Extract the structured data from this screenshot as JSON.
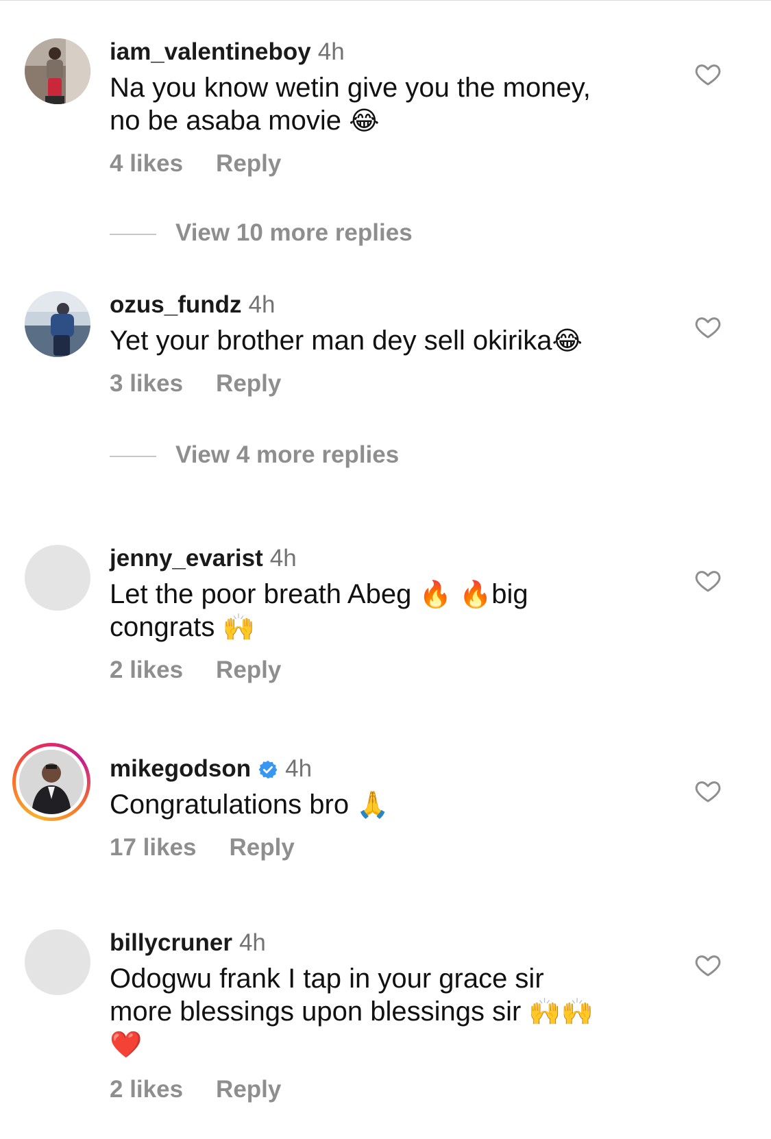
{
  "comments": [
    {
      "username": "iam_valentineboy",
      "time": "4h",
      "text_line1": "Na you know wetin give you the money,",
      "text_line2": "no be asaba movie",
      "emoji": "😂",
      "likes": "4 likes",
      "reply": "Reply",
      "view_replies": "View 10 more replies"
    },
    {
      "username": "ozus_fundz",
      "time": "4h",
      "text_line1": "Yet your brother man dey sell okirika",
      "emoji": "😂",
      "likes": "3 likes",
      "reply": "Reply",
      "view_replies": "View 4 more replies"
    },
    {
      "username": "jenny_evarist",
      "time": "4h",
      "text_line1": "Let the poor breath Abeg",
      "emoji_fire": "🔥",
      "text_line1_end": "big",
      "text_line2": "congrats",
      "emoji_hands": "🙌",
      "likes": "2 likes",
      "reply": "Reply"
    },
    {
      "username": "mikegodson",
      "verified": true,
      "time": "4h",
      "text_line1": "Congratulations bro",
      "emoji": "🙏",
      "likes": "17 likes",
      "reply": "Reply"
    },
    {
      "username": "billycruner",
      "time": "4h",
      "text_line1": "Odogwu frank I tap in your grace sir",
      "text_line2": "more blessings upon blessings sir",
      "emoji_hands": "🙌",
      "emoji_heart": "❤️",
      "likes": "2 likes",
      "reply": "Reply"
    }
  ],
  "colors": {
    "username": "#1a1a1a",
    "secondary_text": "#737373",
    "action_text": "#8e8e8e",
    "verified_badge": "#3897f0",
    "story_ring": [
      "#f9b12a",
      "#e62e5b",
      "#c41f8e"
    ]
  }
}
